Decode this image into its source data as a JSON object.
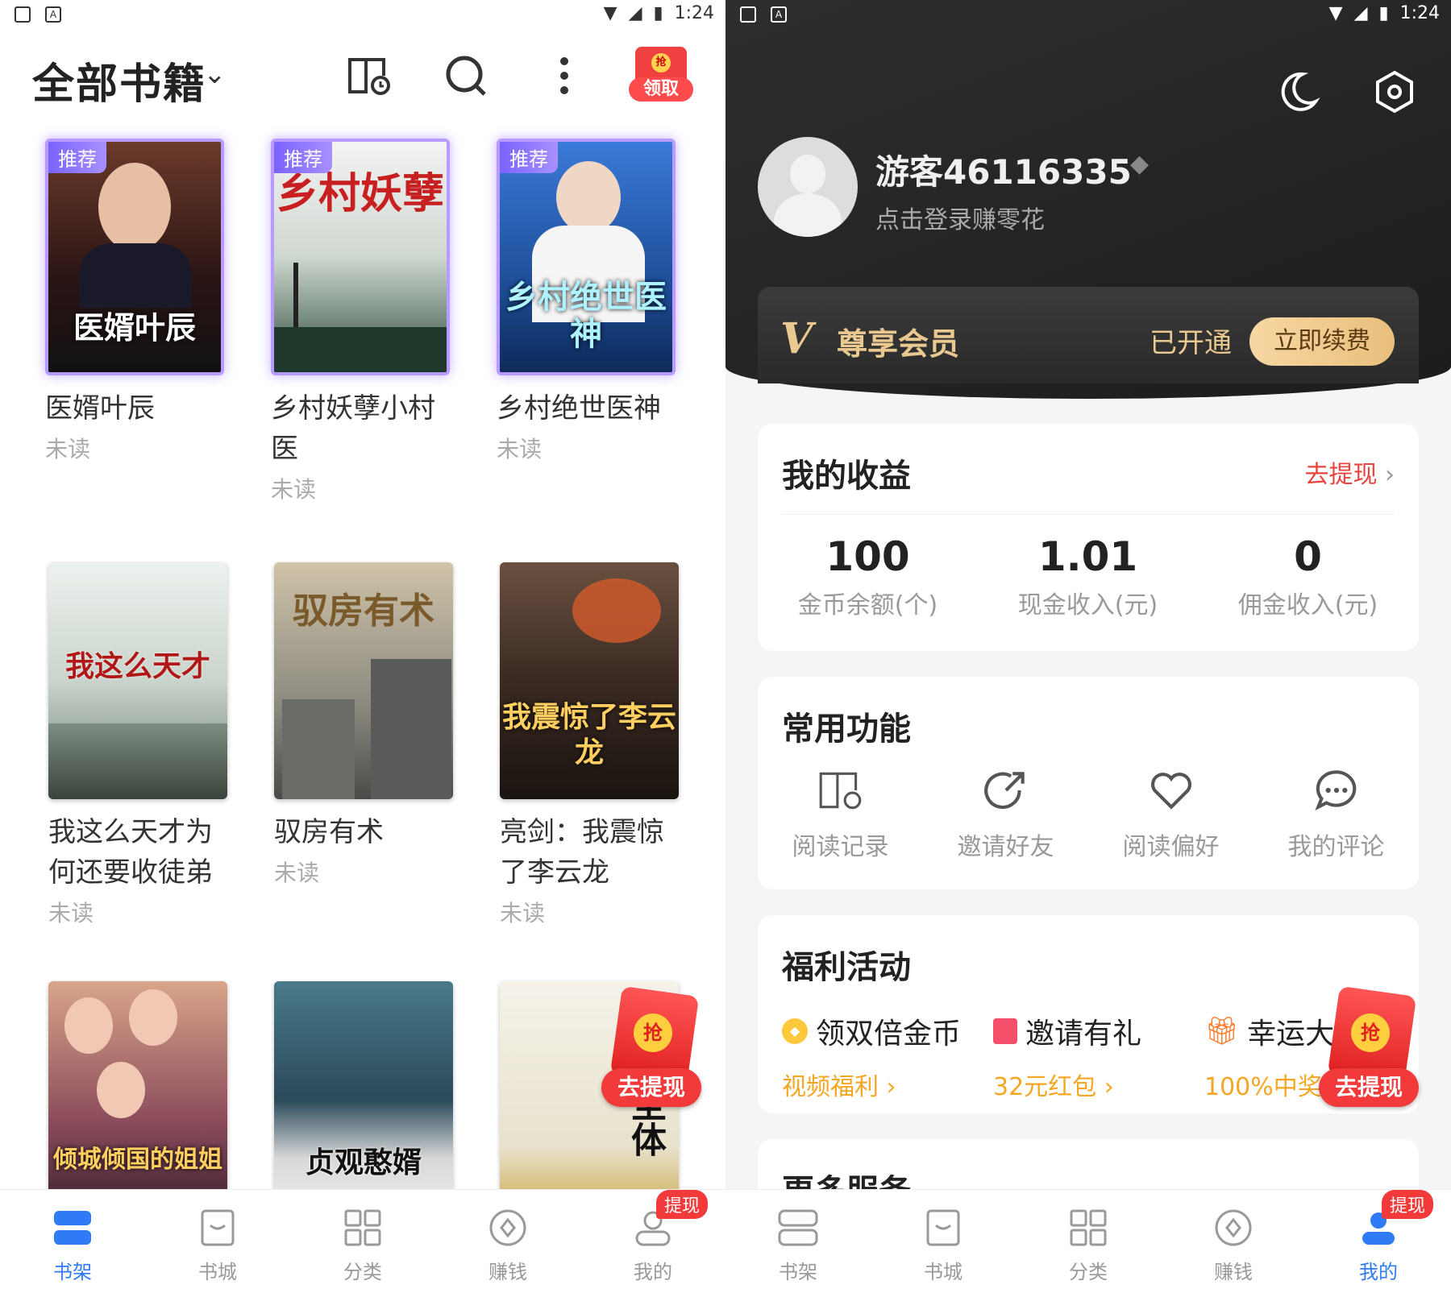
{
  "status": {
    "time": "1:24"
  },
  "left": {
    "title": "全部书籍",
    "redpack_label": "领取",
    "redpack_coin": "抢",
    "books": [
      {
        "title": "医婿叶辰",
        "status": "未读",
        "tag": "推荐",
        "cover_text": "医婿叶辰",
        "recommended": true
      },
      {
        "title": "乡村妖孽小村医",
        "status": "未读",
        "tag": "推荐",
        "cover_text": "乡村妖孽",
        "recommended": true
      },
      {
        "title": "乡村绝世医神",
        "status": "未读",
        "tag": "推荐",
        "cover_text": "乡村绝世医神",
        "recommended": true
      },
      {
        "title": "我这么天才为何还要收徒弟",
        "status": "未读",
        "cover_text": "我这么天才"
      },
      {
        "title": "驭房有术",
        "status": "未读",
        "cover_text": "驭房有术"
      },
      {
        "title": "亮剑：我震惊了李云龙",
        "status": "未读",
        "cover_text": "我震惊了李云龙"
      },
      {
        "cover_text": "倾城倾国的姐姐"
      },
      {
        "cover_text": "贞观憨婿"
      },
      {
        "cover_text": "荒古圣体"
      }
    ],
    "float_btn": "去提现",
    "float_coin": "抢"
  },
  "nav": {
    "items": [
      "书架",
      "书城",
      "分类",
      "赚钱",
      "我的"
    ],
    "badge": "提现"
  },
  "right": {
    "username": "游客46116335",
    "login_hint": "点击登录赚零花",
    "vip": {
      "v": "V",
      "title": "尊享会员",
      "status": "已开通",
      "button": "立即续费"
    },
    "earnings": {
      "title": "我的收益",
      "link": "去提现",
      "stats": [
        {
          "value": "100",
          "label": "金币余额(个)"
        },
        {
          "value": "1.01",
          "label": "现金收入(元)"
        },
        {
          "value": "0",
          "label": "佣金收入(元)"
        }
      ]
    },
    "functions": {
      "title": "常用功能",
      "items": [
        "阅读记录",
        "邀请好友",
        "阅读偏好",
        "我的评论"
      ]
    },
    "welfare": {
      "title": "福利活动",
      "items": [
        {
          "title": "领双倍金币",
          "sub": "视频福利"
        },
        {
          "title": "邀请有礼",
          "sub": "32元红包"
        },
        {
          "title": "幸运大",
          "sub": "100%中奖"
        }
      ]
    },
    "more_title": "更多服务",
    "float_btn": "去提现",
    "float_coin": "抢"
  },
  "colors": {
    "accent": "#2f7bf5",
    "red": "#f23a3a",
    "gold": "#e9c98f",
    "orange": "#f5a623"
  }
}
